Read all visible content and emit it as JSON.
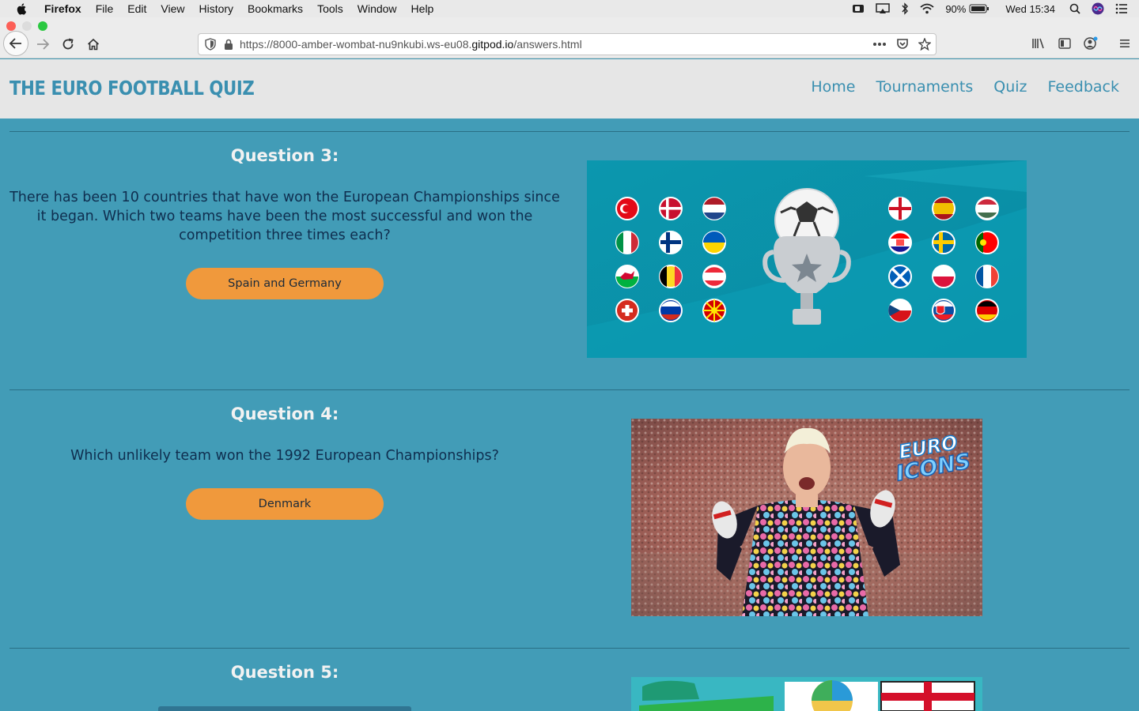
{
  "menubar": {
    "app": "Firefox",
    "items": [
      "File",
      "Edit",
      "View",
      "History",
      "Bookmarks",
      "Tools",
      "Window",
      "Help"
    ],
    "battery": "90%",
    "clock": "Wed 15:34"
  },
  "browser": {
    "url_prefix": "https://8000-amber-wombat-nu9nkubi.ws-eu08.",
    "url_domain": "gitpod.io",
    "url_path": "/answers.html"
  },
  "site": {
    "brand": "THE EURO FOOTBALL QUIZ",
    "nav": [
      "Home",
      "Tournaments",
      "Quiz",
      "Feedback"
    ]
  },
  "questions": [
    {
      "title": "Question 3:",
      "text": "There has been 10 countries that have won the European Championships since it began. Which two teams have been the most successful and won the competition three times each?",
      "answer": "Spain and Germany"
    },
    {
      "title": "Question 4:",
      "text": "Which unlikely team won the 1992 European Championships?",
      "answer": "Denmark"
    },
    {
      "title": "Question 5:"
    }
  ],
  "images": {
    "q4_logo_line1": "EURO",
    "q4_logo_line2": "ICONS"
  },
  "colors": {
    "page_bg": "#429cb7",
    "header_bg": "#e6e6e6",
    "brand": "#3a8fb0",
    "button": "#f0993c"
  }
}
